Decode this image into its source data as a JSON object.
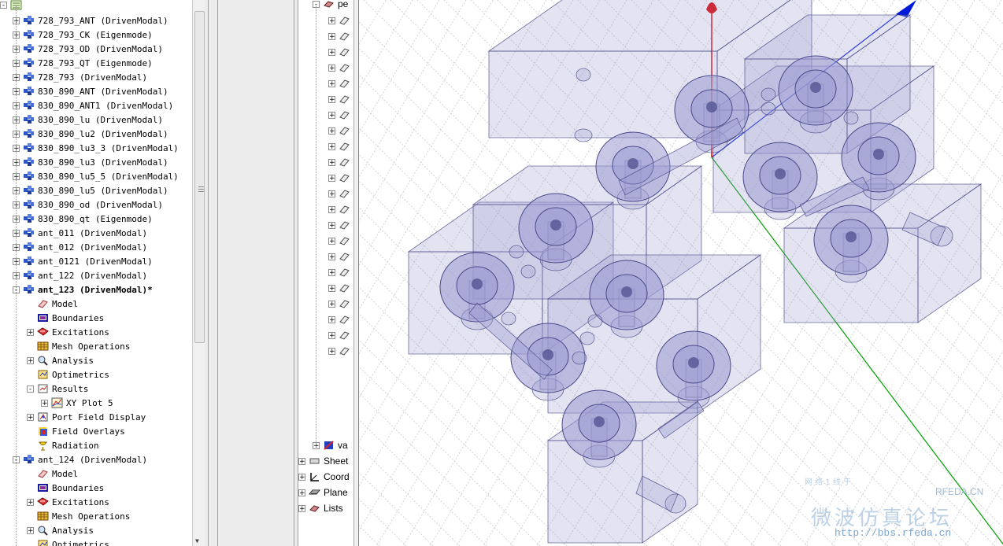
{
  "project_tree": {
    "root_label": "",
    "items": [
      {
        "label": "728_793_ANT (DrivenModal)",
        "level": 0,
        "exp": "+",
        "icon": "hfss-design-icon"
      },
      {
        "label": "728_793_CK (Eigenmode)",
        "level": 0,
        "exp": "+",
        "icon": "hfss-design-icon"
      },
      {
        "label": "728_793_OD (DrivenModal)",
        "level": 0,
        "exp": "+",
        "icon": "hfss-design-icon"
      },
      {
        "label": "728_793_QT (Eigenmode)",
        "level": 0,
        "exp": "+",
        "icon": "hfss-design-icon"
      },
      {
        "label": "728_793 (DrivenModal)",
        "level": 0,
        "exp": "+",
        "icon": "hfss-design-icon"
      },
      {
        "label": "830_890_ANT (DrivenModal)",
        "level": 0,
        "exp": "+",
        "icon": "hfss-design-icon"
      },
      {
        "label": "830_890_ANT1 (DrivenModal)",
        "level": 0,
        "exp": "+",
        "icon": "hfss-design-icon"
      },
      {
        "label": "830_890_lu (DrivenModal)",
        "level": 0,
        "exp": "+",
        "icon": "hfss-design-icon"
      },
      {
        "label": "830_890_lu2 (DrivenModal)",
        "level": 0,
        "exp": "+",
        "icon": "hfss-design-icon"
      },
      {
        "label": "830_890_lu3_3 (DrivenModal)",
        "level": 0,
        "exp": "+",
        "icon": "hfss-design-icon"
      },
      {
        "label": "830_890_lu3 (DrivenModal)",
        "level": 0,
        "exp": "+",
        "icon": "hfss-design-icon"
      },
      {
        "label": "830_890_lu5_5 (DrivenModal)",
        "level": 0,
        "exp": "+",
        "icon": "hfss-design-icon"
      },
      {
        "label": "830_890_lu5 (DrivenModal)",
        "level": 0,
        "exp": "+",
        "icon": "hfss-design-icon"
      },
      {
        "label": "830_890_od (DrivenModal)",
        "level": 0,
        "exp": "+",
        "icon": "hfss-design-icon"
      },
      {
        "label": "830_890_qt (Eigenmode)",
        "level": 0,
        "exp": "+",
        "icon": "hfss-design-icon"
      },
      {
        "label": "ant_011 (DrivenModal)",
        "level": 0,
        "exp": "+",
        "icon": "hfss-design-icon"
      },
      {
        "label": "ant_012 (DrivenModal)",
        "level": 0,
        "exp": "+",
        "icon": "hfss-design-icon"
      },
      {
        "label": "ant_0121 (DrivenModal)",
        "level": 0,
        "exp": "+",
        "icon": "hfss-design-icon"
      },
      {
        "label": "ant_122 (DrivenModal)",
        "level": 0,
        "exp": "+",
        "icon": "hfss-design-icon"
      },
      {
        "label": "ant_123 (DrivenModal)*",
        "level": 0,
        "exp": "-",
        "icon": "hfss-design-icon",
        "bold": true
      },
      {
        "label": "Model",
        "level": 1,
        "exp": "",
        "icon": "model-icon"
      },
      {
        "label": "Boundaries",
        "level": 1,
        "exp": "",
        "icon": "boundaries-icon"
      },
      {
        "label": "Excitations",
        "level": 1,
        "exp": "+",
        "icon": "excitations-icon"
      },
      {
        "label": "Mesh Operations",
        "level": 1,
        "exp": "",
        "icon": "mesh-operations-icon"
      },
      {
        "label": "Analysis",
        "level": 1,
        "exp": "+",
        "icon": "analysis-icon"
      },
      {
        "label": "Optimetrics",
        "level": 1,
        "exp": "",
        "icon": "optimetrics-icon"
      },
      {
        "label": "Results",
        "level": 1,
        "exp": "-",
        "icon": "results-icon"
      },
      {
        "label": "XY Plot 5",
        "level": 2,
        "exp": "+",
        "icon": "xy-plot-icon"
      },
      {
        "label": "Port Field Display",
        "level": 1,
        "exp": "+",
        "icon": "port-field-icon"
      },
      {
        "label": "Field Overlays",
        "level": 1,
        "exp": "",
        "icon": "field-overlays-icon"
      },
      {
        "label": "Radiation",
        "level": 1,
        "exp": "",
        "icon": "radiation-icon"
      },
      {
        "label": "ant_124 (DrivenModal)",
        "level": 0,
        "exp": "-",
        "icon": "hfss-design-icon"
      },
      {
        "label": "Model",
        "level": 1,
        "exp": "",
        "icon": "model-icon"
      },
      {
        "label": "Boundaries",
        "level": 1,
        "exp": "",
        "icon": "boundaries-icon"
      },
      {
        "label": "Excitations",
        "level": 1,
        "exp": "+",
        "icon": "excitations-icon"
      },
      {
        "label": "Mesh Operations",
        "level": 1,
        "exp": "",
        "icon": "mesh-operations-icon"
      },
      {
        "label": "Analysis",
        "level": 1,
        "exp": "+",
        "icon": "analysis-icon"
      },
      {
        "label": "Optimetrics",
        "level": 1,
        "exp": "",
        "icon": "optimetrics-icon"
      }
    ]
  },
  "model_tree": {
    "top_label": "pe",
    "object_rows": 22,
    "bottom_items": [
      {
        "label": "va",
        "level": 1,
        "exp": "+",
        "icon": "vacuum-icon"
      },
      {
        "label": "Sheet",
        "level": 0,
        "exp": "+",
        "icon": "sheet-icon"
      },
      {
        "label": "Coord",
        "level": 0,
        "exp": "+",
        "icon": "coordinate-system-icon"
      },
      {
        "label": "Plane",
        "level": 0,
        "exp": "+",
        "icon": "plane-icon"
      },
      {
        "label": "Lists",
        "level": 0,
        "exp": "+",
        "icon": "lists-icon"
      }
    ]
  },
  "watermark": {
    "cn_title": "微波仿真论坛",
    "url": "http://bbs.rfeda.cn",
    "brand": "RFEDA.CN",
    "small": "网 络 1 线 于"
  },
  "colors": {
    "model_fill": "#9a9ad2",
    "model_stroke": "#4a4a8a",
    "axis_z": "#e00000",
    "axis_x": "#0018d8",
    "axis_y": "#00a000"
  }
}
